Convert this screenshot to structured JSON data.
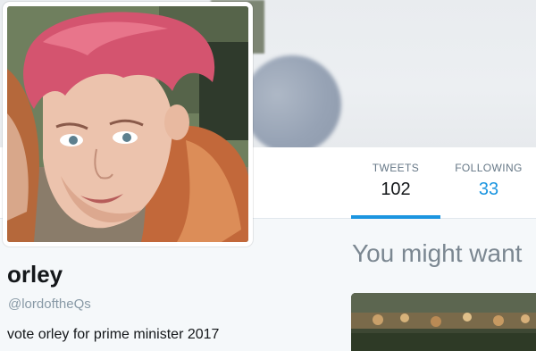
{
  "profile": {
    "name": "orley",
    "handle": "@lordoftheQs",
    "bio": "vote orley for prime minister 2017"
  },
  "nav": {
    "tweets": {
      "label": "TWEETS",
      "value": "102"
    },
    "following": {
      "label": "FOLLOWING",
      "value": "33"
    }
  },
  "sidebar": {
    "heading": "You might want"
  },
  "colors": {
    "accent": "#1b95e0",
    "background": "#f5f8fa",
    "text_secondary": "#657786"
  }
}
